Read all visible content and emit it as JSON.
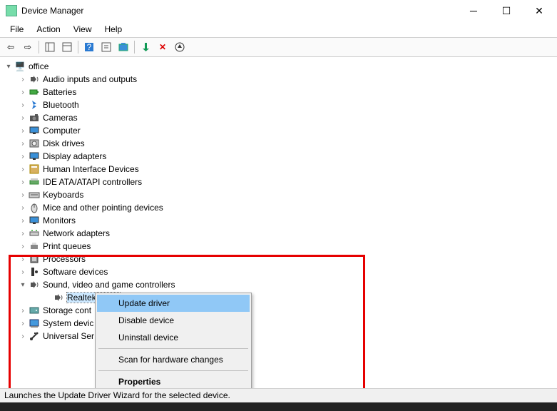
{
  "window": {
    "title": "Device Manager"
  },
  "menus": {
    "file": "File",
    "action": "Action",
    "view": "View",
    "help": "Help"
  },
  "root": "office",
  "categories": [
    {
      "id": "audio-io",
      "label": "Audio inputs and outputs",
      "icon": "speaker"
    },
    {
      "id": "batteries",
      "label": "Batteries",
      "icon": "battery"
    },
    {
      "id": "bluetooth",
      "label": "Bluetooth",
      "icon": "bluetooth"
    },
    {
      "id": "cameras",
      "label": "Cameras",
      "icon": "camera"
    },
    {
      "id": "computer",
      "label": "Computer",
      "icon": "monitor"
    },
    {
      "id": "disk",
      "label": "Disk drives",
      "icon": "disk"
    },
    {
      "id": "display",
      "label": "Display adapters",
      "icon": "monitor"
    },
    {
      "id": "hid",
      "label": "Human Interface Devices",
      "icon": "hid"
    },
    {
      "id": "ide",
      "label": "IDE ATA/ATAPI controllers",
      "icon": "ide"
    },
    {
      "id": "keyboards",
      "label": "Keyboards",
      "icon": "keyboard"
    },
    {
      "id": "mice",
      "label": "Mice and other pointing devices",
      "icon": "mouse"
    },
    {
      "id": "monitors",
      "label": "Monitors",
      "icon": "monitor"
    },
    {
      "id": "network",
      "label": "Network adapters",
      "icon": "network"
    },
    {
      "id": "printq",
      "label": "Print queues",
      "icon": "printer"
    },
    {
      "id": "processors",
      "label": "Processors",
      "icon": "cpu"
    },
    {
      "id": "swdev",
      "label": "Software devices",
      "icon": "swdev"
    },
    {
      "id": "svgc",
      "label": "Sound, video and game controllers",
      "icon": "speaker",
      "expanded": true,
      "children": [
        {
          "id": "realtek",
          "label": "Realtek Audio",
          "icon": "speaker",
          "selected": true
        }
      ]
    },
    {
      "id": "storage",
      "label": "Storage cont",
      "icon": "storage",
      "truncated": true
    },
    {
      "id": "sysdev",
      "label": "System devic",
      "icon": "system",
      "truncated": true
    },
    {
      "id": "usb",
      "label": "Universal Ser",
      "icon": "usb",
      "truncated": true
    }
  ],
  "context_menu": {
    "items": [
      {
        "label": "Update driver",
        "highlight": true
      },
      {
        "label": "Disable device"
      },
      {
        "label": "Uninstall device"
      },
      {
        "sep": true
      },
      {
        "label": "Scan for hardware changes"
      },
      {
        "sep": true
      },
      {
        "label": "Properties",
        "bold": true
      }
    ]
  },
  "status": "Launches the Update Driver Wizard for the selected device."
}
